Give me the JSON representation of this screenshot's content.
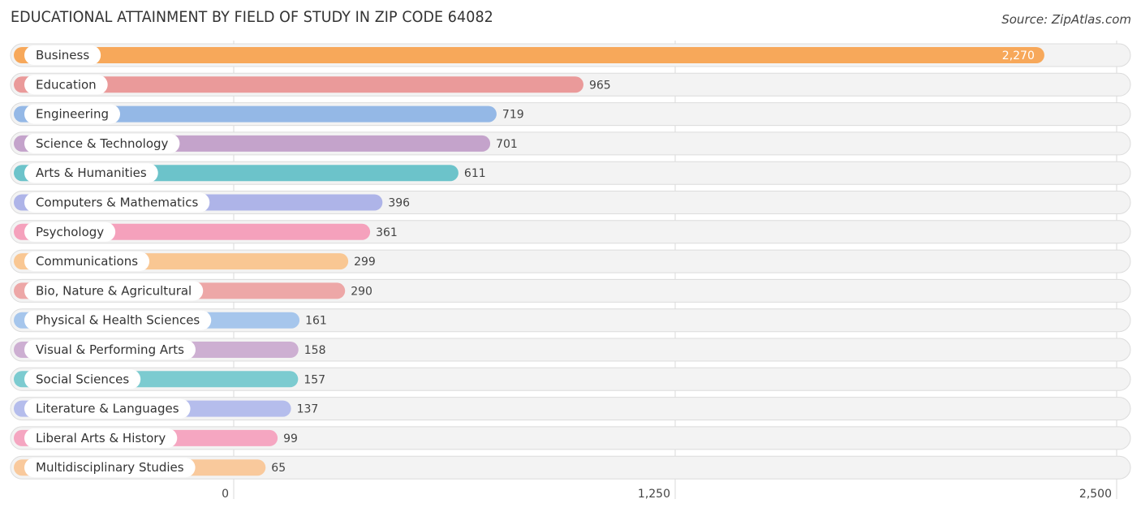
{
  "title": "EDUCATIONAL ATTAINMENT BY FIELD OF STUDY IN ZIP CODE 64082",
  "source": "Source: ZipAtlas.com",
  "chart_data": {
    "type": "bar",
    "orientation": "horizontal",
    "title": "EDUCATIONAL ATTAINMENT BY FIELD OF STUDY IN ZIP CODE 64082",
    "xlabel": "",
    "ylabel": "",
    "xlim": [
      0,
      2500
    ],
    "xticks": [
      0,
      1250,
      2500
    ],
    "xtick_labels": [
      "0",
      "1,250",
      "2,500"
    ],
    "grid": true,
    "categories": [
      "Business",
      "Education",
      "Engineering",
      "Science & Technology",
      "Arts & Humanities",
      "Computers & Mathematics",
      "Psychology",
      "Communications",
      "Bio, Nature & Agricultural",
      "Physical & Health Sciences",
      "Visual & Performing Arts",
      "Social Sciences",
      "Literature & Languages",
      "Liberal Arts & History",
      "Multidisciplinary Studies"
    ],
    "values": [
      2270,
      965,
      719,
      701,
      611,
      396,
      361,
      299,
      290,
      161,
      158,
      157,
      137,
      99,
      65
    ],
    "value_labels": [
      "2,270",
      "965",
      "719",
      "701",
      "611",
      "396",
      "361",
      "299",
      "290",
      "161",
      "158",
      "157",
      "137",
      "99",
      "65"
    ],
    "colors": [
      "#f7a85a",
      "#ea9a9a",
      "#94b8e6",
      "#c4a3cb",
      "#6cc3ca",
      "#aeb4e8",
      "#f5a1bc",
      "#f9c793",
      "#eda7a7",
      "#a6c6ec",
      "#cdafd2",
      "#7ccbd0",
      "#b5bdec",
      "#f5a6c1",
      "#f9c99c"
    ]
  }
}
